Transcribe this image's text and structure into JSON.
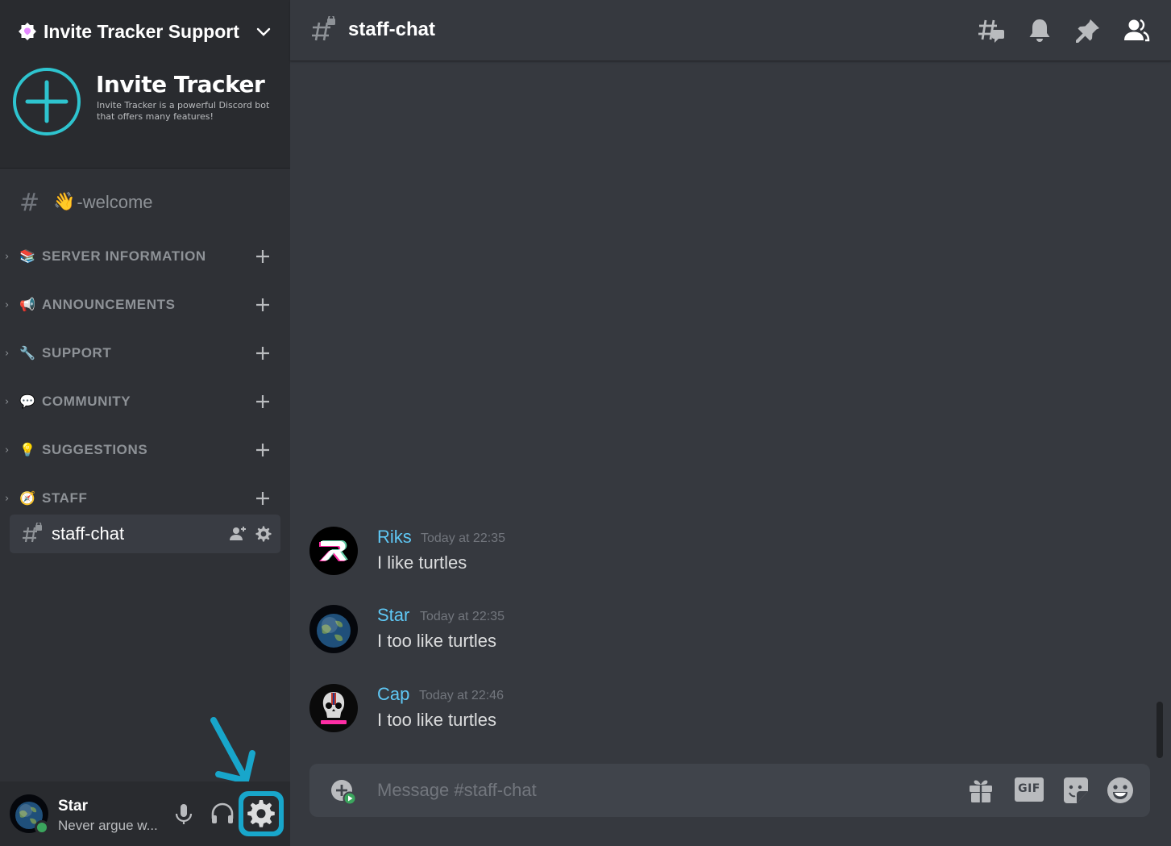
{
  "server": {
    "name": "Invite Tracker Support",
    "banner_title": "Invite Tracker",
    "banner_subtitle": "Invite Tracker is a powerful Discord bot that offers many features!"
  },
  "sidebar": {
    "welcome_channel": {
      "emoji": "👋",
      "label": "-welcome"
    },
    "categories": [
      {
        "emoji": "📚",
        "label": "SERVER INFORMATION"
      },
      {
        "emoji": "📢",
        "label": "ANNOUNCEMENTS"
      },
      {
        "emoji": "🔧",
        "label": "SUPPORT"
      },
      {
        "emoji": "💬",
        "label": "COMMUNITY"
      },
      {
        "emoji": "💡",
        "label": "SUGGESTIONS"
      },
      {
        "emoji": "🧭",
        "label": "STAFF"
      }
    ],
    "active_channel": "staff-chat"
  },
  "user_panel": {
    "name": "Star",
    "status": "Never argue w...",
    "status_color": "#3ba55d"
  },
  "header": {
    "channel_name": "staff-chat"
  },
  "messages": [
    {
      "author": "Riks",
      "time": "Today at 22:35",
      "text": "I like turtles"
    },
    {
      "author": "Star",
      "time": "Today at 22:35",
      "text": "I too like turtles"
    },
    {
      "author": "Cap",
      "time": "Today at 22:46",
      "text": "I too like turtles"
    }
  ],
  "composer": {
    "placeholder": "Message #staff-chat",
    "gif_label": "GIF"
  },
  "colors": {
    "accent_highlight": "#18a6cb",
    "author_name": "#5fc8f5",
    "background": "#36393f",
    "sidebar": "#2f3136"
  }
}
